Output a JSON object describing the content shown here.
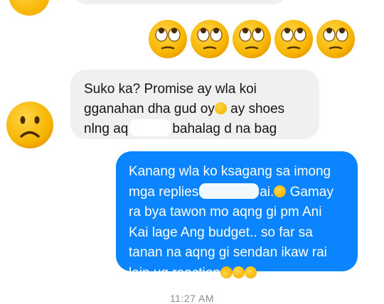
{
  "chat": {
    "incoming_message": {
      "line1": "Suko ka? Promise ay wla koi",
      "line2_text": "gganahan dha gud oy",
      "line2_emoji": "pensive-face-emoji",
      "line2_after": " ay shoes",
      "line3_before": "nlng aq",
      "line3_after": "bahalag d na bag"
    },
    "outgoing_message": {
      "line1": "Kanang wla ko ksagang sa imong",
      "line2_before": "mga replies",
      "line2_after": "ai.",
      "line2_emoji": "frowning-face-emoji",
      "line2_tail": " Gamay",
      "line3": "ra bya tawon mo aqng gi pm Ani",
      "line4": "Kai lage Ang budget.. so far sa",
      "line5": "tanan na aqng gi sendan ikaw rai",
      "line6": "lain ug reaction"
    },
    "reaction_emojis": [
      "face-with-rolling-eyes",
      "face-with-rolling-eyes",
      "face-with-rolling-eyes",
      "face-with-rolling-eyes",
      "face-with-rolling-eyes"
    ],
    "timestamp": "11:27 AM"
  },
  "colors": {
    "outgoing_bubble": "#0a84ff",
    "incoming_bubble": "#f0f0f0",
    "emoji_yellow": "#f7b500",
    "timestamp_gray": "#8a8d91"
  }
}
